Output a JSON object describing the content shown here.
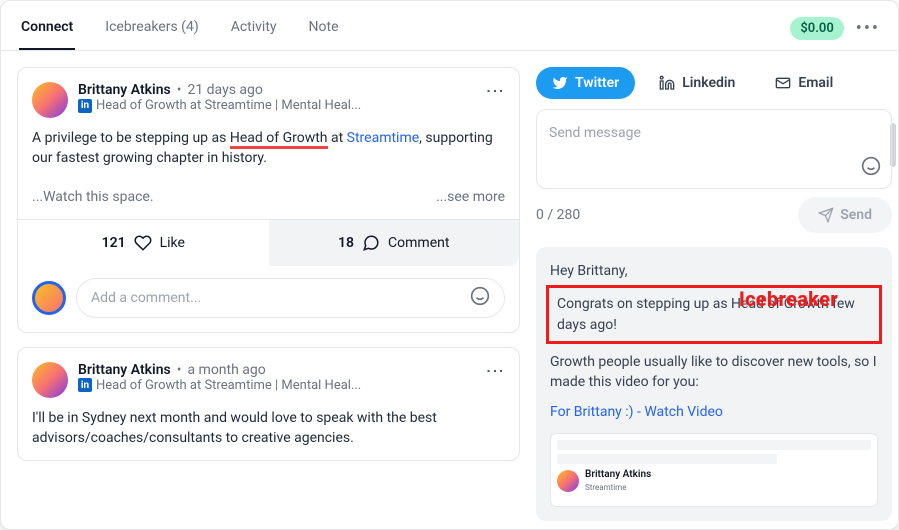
{
  "tabs": {
    "connect": "Connect",
    "icebreakers": "Icebreakers (4)",
    "activity": "Activity",
    "note": "Note"
  },
  "header": {
    "balance": "$0.00"
  },
  "post1": {
    "name": "Brittany Atkins",
    "time": "21 days ago",
    "role_prefix": "Head of Growth at Streamtime | Mental Heal...",
    "body_a": "A privilege to be stepping up as ",
    "body_hl": "Head of Growth",
    "body_b": " at ",
    "body_link": "Streamtime",
    "body_c": ", supporting our fastest growing chapter in history.",
    "watch": "...Watch this space.",
    "see_more": "...see more",
    "likes": "121",
    "like_label": "Like",
    "comments": "18",
    "comment_label": "Comment",
    "add_comment_ph": "Add a comment..."
  },
  "post2": {
    "name": "Brittany Atkins",
    "time": "a month ago",
    "role_prefix": "Head of Growth at Streamtime | Mental Heal...",
    "body": "I'll be in Sydney next month and would love to speak with the best advisors/coaches/consultants to creative agencies."
  },
  "channels": {
    "twitter": "Twitter",
    "linkedin": "Linkedin",
    "email": "Email"
  },
  "compose": {
    "placeholder": "Send message",
    "counter": "0 / 280",
    "send": "Send"
  },
  "icebreaker": {
    "label": "Icebreaker",
    "greeting": "Hey Brittany,",
    "boxed": "Congrats on stepping up as Head of Growth few days ago!",
    "line2": "Growth people usually like to discover new tools, so I made this video for you:",
    "link": "For Brittany :) - Watch Video",
    "preview_name": "Brittany Atkins",
    "preview_sub": "Streamtime"
  }
}
